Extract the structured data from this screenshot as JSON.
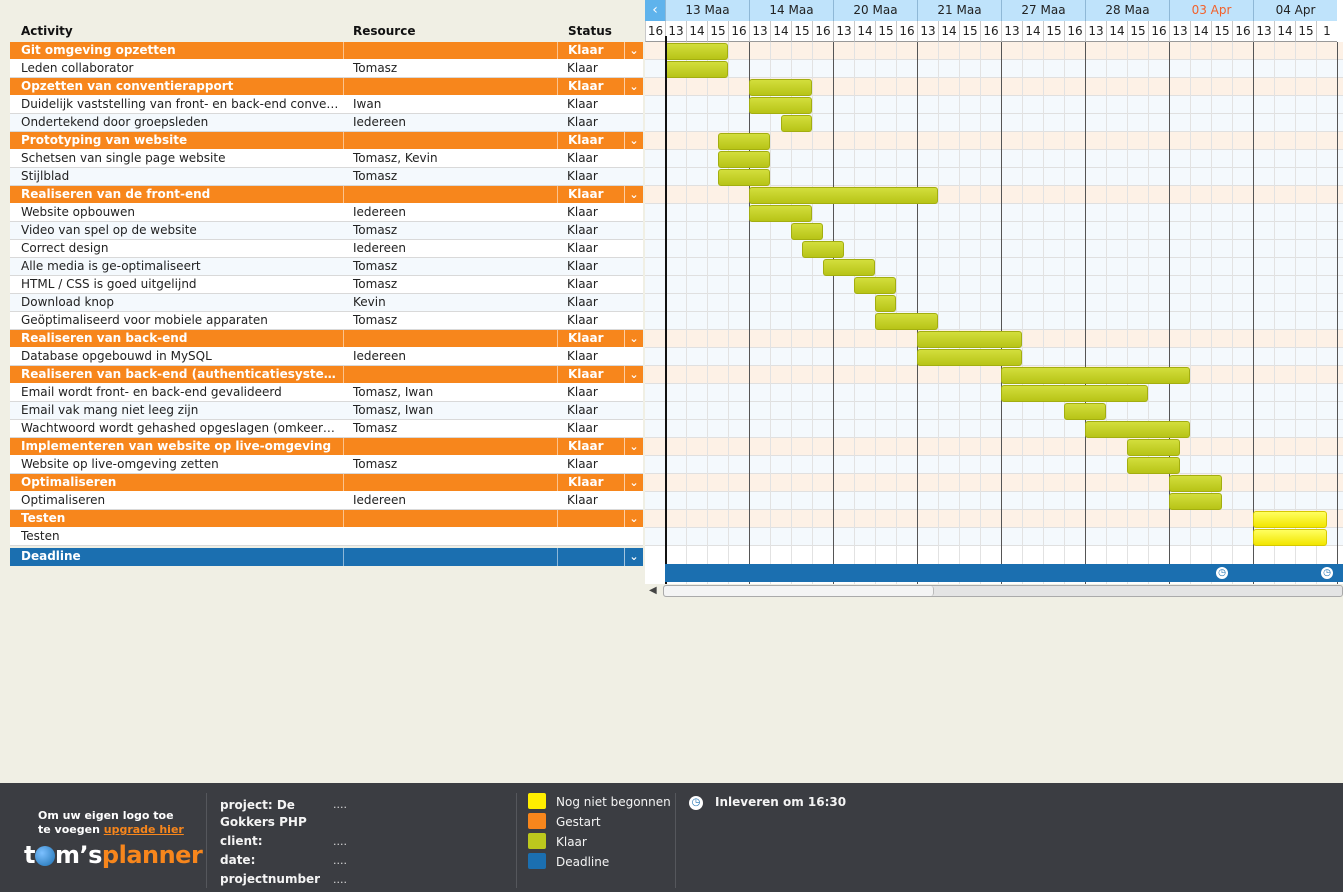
{
  "columns": {
    "activity": "Activity",
    "resource": "Resource",
    "status": "Status"
  },
  "weeks": [
    "13 Maa",
    "14 Maa",
    "20 Maa",
    "21 Maa",
    "27 Maa",
    "28 Maa",
    "03 Apr",
    "04 Apr"
  ],
  "hours": [
    "16",
    "13",
    "14",
    "15",
    "16",
    "13",
    "14",
    "15",
    "16",
    "13",
    "14",
    "15",
    "16",
    "13",
    "14",
    "15",
    "16",
    "13",
    "14",
    "15",
    "16",
    "13",
    "14",
    "15",
    "16",
    "13",
    "14",
    "15",
    "16",
    "13",
    "14",
    "15",
    "1"
  ],
  "rows": [
    {
      "type": "group",
      "activity": "Git omgeving opzetten",
      "resource": "",
      "status": "Klaar",
      "bar": [
        1,
        3
      ]
    },
    {
      "type": "task",
      "activity": "Leden collaborator",
      "resource": "Tomasz",
      "status": "Klaar",
      "bar": [
        1,
        3
      ]
    },
    {
      "type": "group",
      "activity": "Opzetten van conventierapport",
      "resource": "",
      "status": "Klaar",
      "bar": [
        5,
        7
      ]
    },
    {
      "type": "task",
      "activity": "Duidelijk vaststelling van front- en back-end conventies",
      "resource": "Iwan",
      "status": "Klaar",
      "bar": [
        5,
        7
      ]
    },
    {
      "type": "task",
      "activity": "Ondertekend door groepsleden",
      "resource": "Iedereen",
      "status": "Klaar",
      "bar": [
        6.5,
        7
      ]
    },
    {
      "type": "group",
      "activity": "Prototyping van website",
      "resource": "",
      "status": "Klaar",
      "bar": [
        3.5,
        5
      ]
    },
    {
      "type": "task",
      "activity": "Schetsen van single page website",
      "resource": "Tomasz, Kevin",
      "status": "Klaar",
      "bar": [
        3.5,
        5
      ]
    },
    {
      "type": "task",
      "activity": "Stijlblad",
      "resource": "Tomasz",
      "status": "Klaar",
      "bar": [
        3.5,
        5
      ]
    },
    {
      "type": "group",
      "activity": "Realiseren van de front-end",
      "resource": "",
      "status": "Klaar",
      "bar": [
        5,
        13
      ]
    },
    {
      "type": "task",
      "activity": "Website opbouwen",
      "resource": "Iedereen",
      "status": "Klaar",
      "bar": [
        5,
        7
      ]
    },
    {
      "type": "task",
      "activity": "Video van spel op de website",
      "resource": "Tomasz",
      "status": "Klaar",
      "bar": [
        7,
        7.5
      ]
    },
    {
      "type": "task",
      "activity": "Correct design",
      "resource": "Iedereen",
      "status": "Klaar",
      "bar": [
        7.5,
        8.5
      ]
    },
    {
      "type": "task",
      "activity": "Alle media is ge-optimaliseert",
      "resource": "Tomasz",
      "status": "Klaar",
      "bar": [
        8.5,
        10
      ]
    },
    {
      "type": "task",
      "activity": "HTML / CSS is goed uitgelijnd",
      "resource": "Tomasz",
      "status": "Klaar",
      "bar": [
        10,
        11
      ]
    },
    {
      "type": "task",
      "activity": "Download knop",
      "resource": "Kevin",
      "status": "Klaar",
      "bar": [
        11,
        11
      ]
    },
    {
      "type": "task",
      "activity": "Geöptimaliseerd voor mobiele apparaten",
      "resource": "Tomasz",
      "status": "Klaar",
      "bar": [
        11,
        13
      ]
    },
    {
      "type": "group",
      "activity": "Realiseren van back-end",
      "resource": "",
      "status": "Klaar",
      "bar": [
        13,
        17
      ]
    },
    {
      "type": "task",
      "activity": "Database opgebouwd in MySQL",
      "resource": "Iedereen",
      "status": "Klaar",
      "bar": [
        13,
        17
      ]
    },
    {
      "type": "group",
      "activity": "Realiseren van back-end (authenticatiesysteem)",
      "resource": "",
      "status": "Klaar",
      "bar": [
        17,
        25
      ]
    },
    {
      "type": "task",
      "activity": "Email wordt front- en back-end gevalideerd",
      "resource": "Tomasz, Iwan",
      "status": "Klaar",
      "bar": [
        17,
        23
      ]
    },
    {
      "type": "task",
      "activity": "Email vak mang niet leeg zijn",
      "resource": "Tomasz, Iwan",
      "status": "Klaar",
      "bar": [
        20,
        21
      ]
    },
    {
      "type": "task",
      "activity": "Wachtwoord wordt gehashed opgeslagen (omkeerbaar...",
      "resource": "Tomasz",
      "status": "Klaar",
      "bar": [
        21,
        25
      ]
    },
    {
      "type": "group",
      "activity": "Implementeren van website op live-omgeving",
      "resource": "",
      "status": "Klaar",
      "bar": [
        23,
        24.5
      ]
    },
    {
      "type": "task",
      "activity": "Website op live-omgeving zetten",
      "resource": "Tomasz",
      "status": "Klaar",
      "bar": [
        23,
        24.5
      ]
    },
    {
      "type": "group",
      "activity": "Optimaliseren",
      "resource": "",
      "status": "Klaar",
      "bar": [
        25,
        26.5
      ]
    },
    {
      "type": "task",
      "activity": "Optimaliseren",
      "resource": "Iedereen",
      "status": "Klaar",
      "bar": [
        25,
        26.5
      ]
    },
    {
      "type": "group",
      "activity": "Testen",
      "resource": "",
      "status": "",
      "bar": [
        29,
        31.5
      ],
      "ns": true
    },
    {
      "type": "task",
      "activity": "Testen",
      "resource": "",
      "status": "",
      "bar": [
        29,
        31.5
      ],
      "ns": true
    }
  ],
  "deadline": {
    "activity": "Deadline"
  },
  "footer": {
    "logo_line1": "Om uw eigen logo toe",
    "logo_line2": "te voegen",
    "logo_link": "upgrade hier",
    "brand": "t m's planner",
    "project_label": "project: De Gokkers PHP",
    "client_label": "client:",
    "date_label": "date:",
    "projectnumber_label": "projectnumber",
    "dots": "....",
    "legend": [
      {
        "label": "Nog niet begonnen",
        "color": "#ffee00"
      },
      {
        "label": "Gestart",
        "color": "#f7861c"
      },
      {
        "label": "Klaar",
        "color": "#bcc81d"
      },
      {
        "label": "Deadline",
        "color": "#1b6fb0"
      }
    ],
    "deadline_note": "Inleveren om 16:30"
  }
}
